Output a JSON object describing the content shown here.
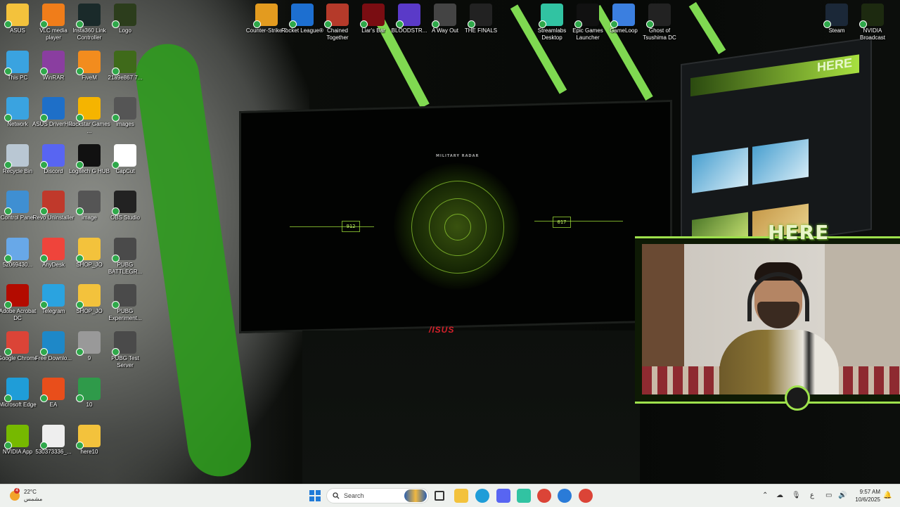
{
  "desktop": {
    "left_icons": [
      {
        "label": "ASUS",
        "icon": "folder-icon",
        "color": "#f3c23c"
      },
      {
        "label": "VLC media player",
        "icon": "vlc-icon",
        "color": "#f07d1a"
      },
      {
        "label": "Insta360 Link Controller",
        "icon": "insta360-icon",
        "color": "#1a2a2a"
      },
      {
        "label": "Logo",
        "icon": "logo-image-icon",
        "color": "#2c3d1c"
      },
      {
        "label": "This PC",
        "icon": "computer-icon",
        "color": "#3aa3e0"
      },
      {
        "label": "WinRAR",
        "icon": "winrar-icon",
        "color": "#8a3ea0"
      },
      {
        "label": "FiveM",
        "icon": "fivem-icon",
        "color": "#f28c1e"
      },
      {
        "label": "21a9e867 7...",
        "icon": "image-file-icon",
        "color": "#3f6a1a"
      },
      {
        "label": "Network",
        "icon": "network-icon",
        "color": "#3aa3e0"
      },
      {
        "label": "ASUS DriverHub",
        "icon": "driverhub-icon",
        "color": "#1e6fc8"
      },
      {
        "label": "Rockstar Games ...",
        "icon": "rockstar-icon",
        "color": "#f5b400"
      },
      {
        "label": "images",
        "icon": "image-file-icon",
        "color": "#555"
      },
      {
        "label": "Recycle Bin",
        "icon": "recycle-bin-icon",
        "color": "#b9c7d3"
      },
      {
        "label": "Discord",
        "icon": "discord-icon",
        "color": "#5865f2"
      },
      {
        "label": "Logitech G HUB",
        "icon": "logitech-icon",
        "color": "#111"
      },
      {
        "label": "CapCut",
        "icon": "capcut-icon",
        "color": "#fff"
      },
      {
        "label": "Control Panel",
        "icon": "control-panel-icon",
        "color": "#3f8fd2"
      },
      {
        "label": "Revo Uninstaller",
        "icon": "revo-icon",
        "color": "#c0392b"
      },
      {
        "label": "image",
        "icon": "image-file-icon",
        "color": "#555"
      },
      {
        "label": "OBS Studio",
        "icon": "obs-icon",
        "color": "#222"
      },
      {
        "label": "52069430...",
        "icon": "file-icon",
        "color": "#68a8e8"
      },
      {
        "label": "AnyDesk",
        "icon": "anydesk-icon",
        "color": "#ef443b"
      },
      {
        "label": "SHOP_JO",
        "icon": "folder-icon",
        "color": "#f3c23c"
      },
      {
        "label": "PUBG BATTLEGR...",
        "icon": "pubg-icon",
        "color": "#4a4a4a"
      },
      {
        "label": "Adobe Acrobat DC",
        "icon": "acrobat-icon",
        "color": "#b30b00"
      },
      {
        "label": "Telegram",
        "icon": "telegram-icon",
        "color": "#2aa3e0"
      },
      {
        "label": "SHOP_JO",
        "icon": "folder-icon",
        "color": "#f3c23c"
      },
      {
        "label": "PUBG Experiment...",
        "icon": "pubg-icon",
        "color": "#4a4a4a"
      },
      {
        "label": "Google Chrome",
        "icon": "chrome-icon",
        "color": "#db4437"
      },
      {
        "label": "Free Downlo...",
        "icon": "download-manager-icon",
        "color": "#1e88c8"
      },
      {
        "label": "9",
        "icon": "image-file-icon",
        "color": "#999"
      },
      {
        "label": "PUBG Test Server",
        "icon": "pubg-icon",
        "color": "#4a4a4a"
      },
      {
        "label": "Microsoft Edge",
        "icon": "edge-icon",
        "color": "#1f9dd8"
      },
      {
        "label": "EA",
        "icon": "ea-icon",
        "color": "#e94e1b"
      },
      {
        "label": "10",
        "icon": "image-file-icon",
        "color": "#2f9a4a"
      },
      {
        "label": "",
        "icon": "blank-icon",
        "color": ""
      },
      {
        "label": "NVIDIA App",
        "icon": "nvidia-icon",
        "color": "#76b900"
      },
      {
        "label": "530373336_...",
        "icon": "image-file-icon",
        "color": "#eee"
      },
      {
        "label": "here10",
        "icon": "folder-icon",
        "color": "#f3c23c"
      }
    ],
    "top_icons": [
      {
        "label": "Counter-Strike 2",
        "icon": "cs2-icon",
        "color": "#e39b1f"
      },
      {
        "label": "Rocket League®",
        "icon": "rocket-league-icon",
        "color": "#1d6fd0"
      },
      {
        "label": "Chained Together",
        "icon": "chained-together-icon",
        "color": "#b53a2a"
      },
      {
        "label": "Liar's Bar",
        "icon": "liars-bar-icon",
        "color": "#7a0d12"
      },
      {
        "label": "BLOODSTR...",
        "icon": "bloodstrike-icon",
        "color": "#5a3ac8"
      },
      {
        "label": "A Way Out",
        "icon": "a-way-out-icon",
        "color": "#444"
      },
      {
        "label": "THE FINALS",
        "icon": "the-finals-icon",
        "color": "#222"
      },
      {
        "label": "Streamlabs Desktop",
        "icon": "streamlabs-icon",
        "color": "#31c3a2"
      },
      {
        "label": "Epic Games Launcher",
        "icon": "epic-games-icon",
        "color": "#111"
      },
      {
        "label": "GameLoop",
        "icon": "gameloop-icon",
        "color": "#3b7fe0"
      },
      {
        "label": "Ghost of Tsushima DC",
        "icon": "ghost-of-tsushima-icon",
        "color": "#222"
      }
    ],
    "right_icons": [
      {
        "label": "Steam",
        "icon": "steam-icon",
        "color": "#1b2838"
      },
      {
        "label": "NVIDIA Broadcast",
        "icon": "nvidia-broadcast-icon",
        "color": "#1d2a10"
      }
    ]
  },
  "wallpaper": {
    "radar_title": "MILITARY RADAR",
    "radar_left_readout": "912",
    "radar_right_readout": "017",
    "monitor_brand": "/ISUS",
    "second_monitor_banner": "HERE"
  },
  "overlay": {
    "here_label": "HERE"
  },
  "taskbar": {
    "weather_temp": "22°C",
    "weather_desc": "مشمس",
    "weather_badge": "4",
    "search_placeholder": "Search",
    "pinned": [
      {
        "name": "file-explorer-icon",
        "color": "#f3c23c"
      },
      {
        "name": "edge-icon",
        "color": "#1f9dd8"
      },
      {
        "name": "discord-icon",
        "color": "#5865f2"
      },
      {
        "name": "streamlabs-icon",
        "color": "#31c3a2"
      },
      {
        "name": "chrome-icon",
        "color": "#db4437"
      },
      {
        "name": "browser-icon",
        "color": "#2a7bd8"
      },
      {
        "name": "chrome-profile-icon",
        "color": "#db4437"
      }
    ],
    "tray_language": "ع",
    "clock_time": "9:57 AM",
    "clock_date": "10/6/2025"
  }
}
